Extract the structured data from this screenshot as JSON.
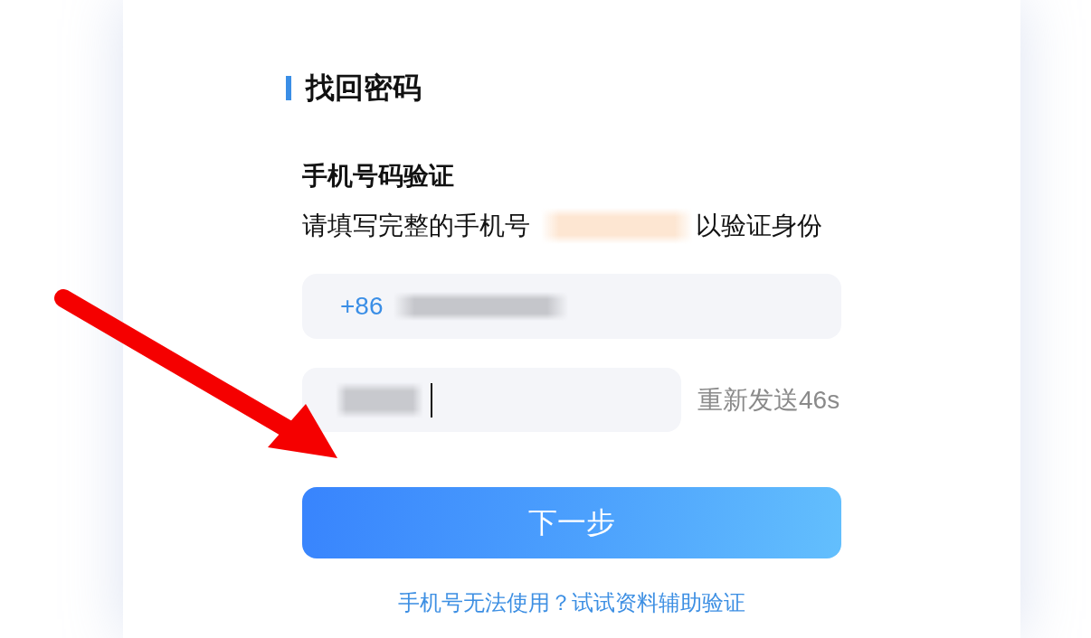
{
  "page": {
    "title": "找回密码"
  },
  "verification": {
    "heading": "手机号码验证",
    "instruction": "请填写完整的手机号",
    "instruction_phone_redacted": true,
    "instruction_suffix": "以验证身份"
  },
  "phone_field": {
    "prefix": "+86",
    "value_redacted": true
  },
  "code_field": {
    "value_redacted": true,
    "focused": true
  },
  "resend": {
    "label": "重新发送46s",
    "disabled": true
  },
  "next_button": {
    "label": "下一步"
  },
  "help_link": {
    "label": "手机号无法使用？试试资料辅助验证"
  },
  "annotation": {
    "kind": "arrow"
  }
}
